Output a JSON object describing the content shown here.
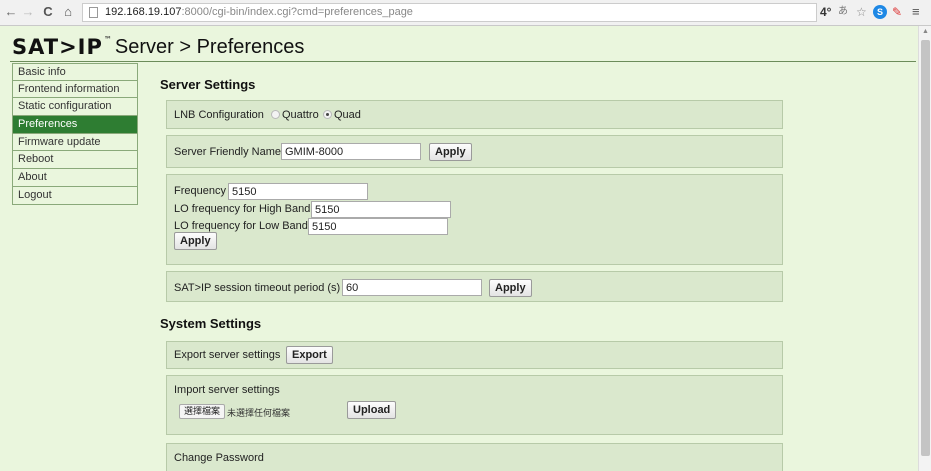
{
  "browser": {
    "url_host": "192.168.19.107",
    "url_path": ":8000/cgi-bin/index.cgi?cmd=preferences_page",
    "temp_badge": "4°"
  },
  "header": {
    "logo": "SAT>IP",
    "logo_tm": "™",
    "title": "Server > Preferences"
  },
  "sidebar": {
    "items": [
      {
        "label": "Basic info"
      },
      {
        "label": "Frontend information"
      },
      {
        "label": "Static configuration"
      },
      {
        "label": "Preferences"
      },
      {
        "label": "Firmware update"
      },
      {
        "label": "Reboot"
      },
      {
        "label": "About"
      },
      {
        "label": "Logout"
      }
    ]
  },
  "server_settings": {
    "title": "Server Settings",
    "lnb": {
      "label": "LNB Configuration",
      "options": [
        "Quattro",
        "Quad"
      ],
      "selected": "Quad"
    },
    "friendly_name": {
      "label": "Server Friendly Name",
      "value": "GMIM-8000",
      "apply_label": "Apply"
    },
    "frequency": {
      "freq_label": "Frequency",
      "freq_value": "5150",
      "lo_high_label": "LO frequency for High Band",
      "lo_high_value": "5150",
      "lo_low_label": "LO frequency for Low Band",
      "lo_low_value": "5150",
      "apply_label": "Apply"
    },
    "timeout": {
      "label": "SAT>IP session timeout period (s)",
      "value": "60",
      "apply_label": "Apply"
    }
  },
  "system_settings": {
    "title": "System Settings",
    "export": {
      "label": "Export server settings",
      "button_label": "Export"
    },
    "import": {
      "label": "Import server settings",
      "choose_file_label": "選擇檔案",
      "file_status": "未選擇任何檔案",
      "upload_label": "Upload"
    },
    "change_password": {
      "label": "Change Password"
    }
  },
  "colors": {
    "page_bg": "#eaf6dd",
    "panel_bg": "#dae8cd",
    "active_nav": "#2e7d32"
  }
}
